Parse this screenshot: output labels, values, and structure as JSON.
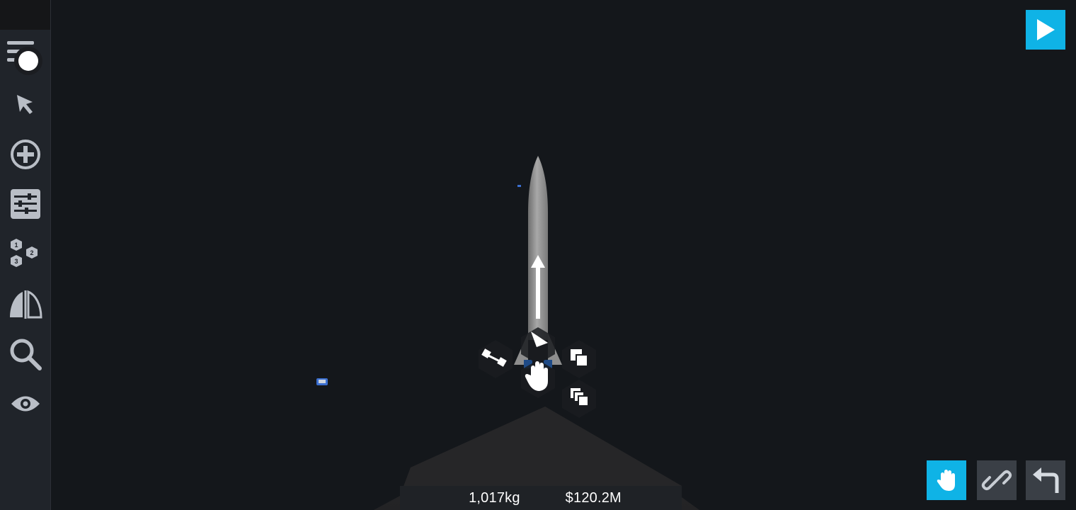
{
  "sidebar": {
    "tools": [
      {
        "name": "menu"
      },
      {
        "name": "select"
      },
      {
        "name": "add-part"
      },
      {
        "name": "properties"
      },
      {
        "name": "staging"
      },
      {
        "name": "symmetry"
      },
      {
        "name": "zoom"
      },
      {
        "name": "view"
      }
    ]
  },
  "toolbar": {
    "play": "play-icon",
    "move_mode": "hand-icon",
    "connect_mode": "link-icon",
    "undo": "undo-icon"
  },
  "stats": {
    "mass": "1,017kg",
    "cost": "$120.2M"
  },
  "colors": {
    "accent": "#0fb3e6",
    "background": "#14171b",
    "sidebar": "#20242a",
    "button_dark": "#3a3f46"
  }
}
